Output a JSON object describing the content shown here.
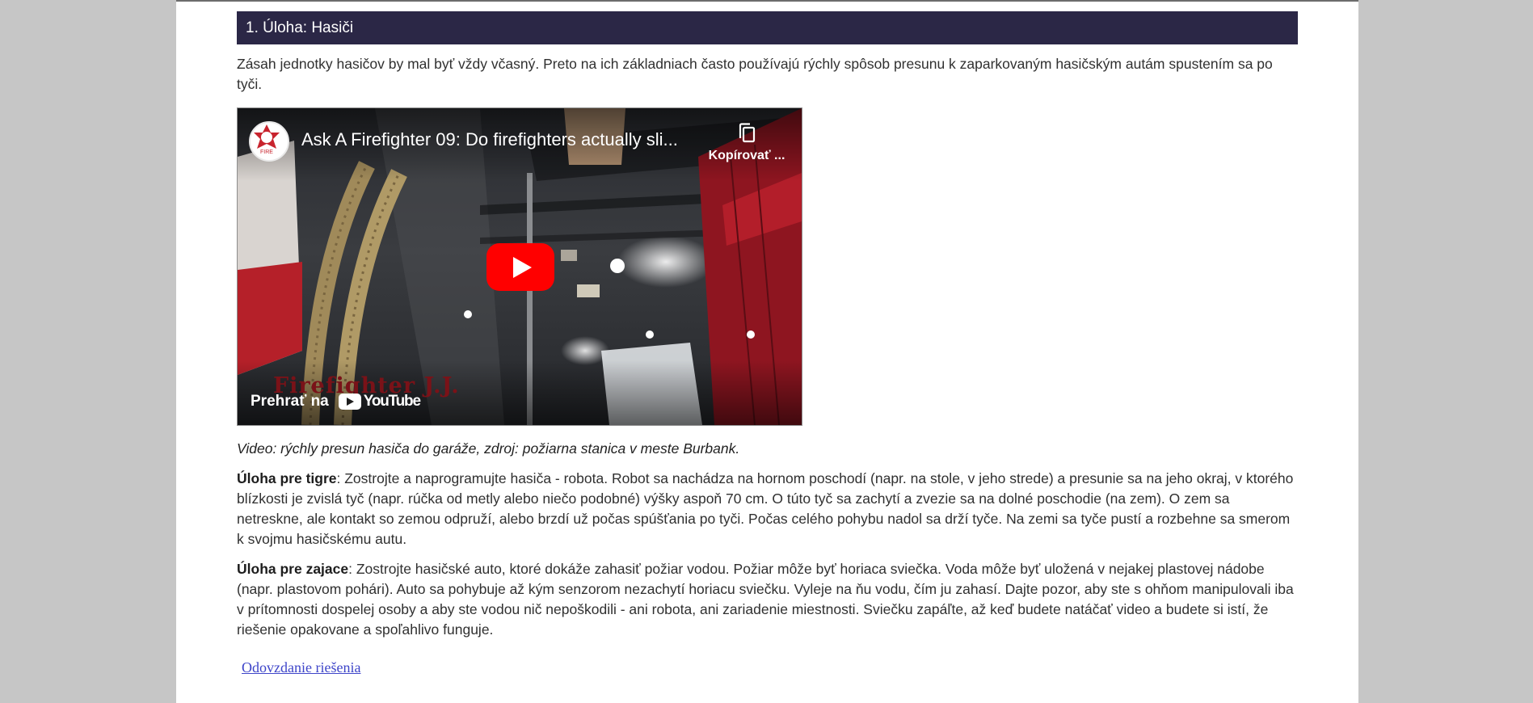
{
  "task": {
    "heading": "1. Úloha: Hasiči",
    "intro": "Zásah jednotky hasičov by mal byť vždy včasný. Preto na ich základniach často používajú rýchly spôsob presunu k zaparkovaným hasičským autám spustením sa po tyči."
  },
  "video": {
    "title": "Ask A Firefighter 09: Do firefighters actually sli...",
    "copy_label": "Kopírovať ...",
    "watch_label": "Prehrať na",
    "platform": "YouTube",
    "watermark": "Firefighter J.J.",
    "channel_logo_text": "FIRE",
    "play_icon": "play-icon",
    "copy_icon": "copy-icon",
    "brand_color": "#ff0000"
  },
  "caption": "Video: rýchly presun hasiča do garáže, zdroj: požiarna stanica v meste Burbank.",
  "tiger": {
    "label": "Úloha pre tigre",
    "text": ": Zostrojte a naprogramujte hasiča - robota. Robot sa nachádza na hornom poschodí (napr. na stole, v jeho strede) a presunie sa na jeho okraj, v ktorého blízkosti je zvislá tyč (napr. rúčka od metly alebo niečo podobné) výšky aspoň 70 cm. O túto tyč sa zachytí a zvezie sa na dolné poschodie (na zem). O zem sa netreskne, ale kontakt so zemou odpruží, alebo brzdí už počas spúšťania po tyči. Počas celého pohybu nadol sa drží tyče. Na zemi sa tyče pustí a rozbehne sa smerom k svojmu hasičskému autu."
  },
  "hare": {
    "label": "Úloha pre zajace",
    "text": ": Zostrojte hasičské auto, ktoré dokáže zahasiť požiar vodou. Požiar môže byť horiaca sviečka. Voda môže byť uložená v nejakej plastovej nádobe (napr. plastovom pohári). Auto sa pohybuje až kým senzorom nezachytí horiacu sviečku. Vyleje na ňu vodu, čím ju zahasí. Dajte pozor, aby ste s ohňom manipulovali iba v prítomnosti dospelej osoby a aby ste vodou nič nepoškodili - ani robota, ani zariadenie miestnosti. Sviečku zapáľte, až keď budete natáčať video a budete si istí, že riešenie opakovane a spoľahlivo funguje."
  },
  "solution_link": "Odovzdanie riešenia"
}
